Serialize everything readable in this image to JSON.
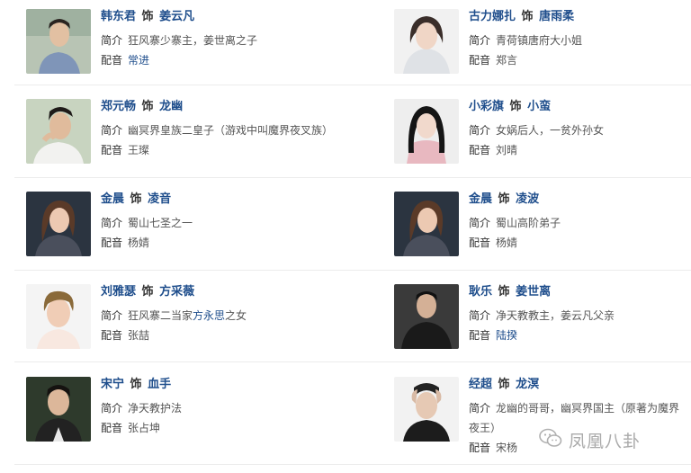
{
  "cast": [
    {
      "actor": "韩东君",
      "role_word": "饰",
      "character": "姜云凡",
      "intro_label": "简介",
      "intro": "狂风寨少寨主，姜世离之子",
      "voice_label": "配音",
      "voice": "常进"
    },
    {
      "actor": "古力娜扎",
      "role_word": "饰",
      "character": "唐雨柔",
      "intro_label": "简介",
      "intro": "青荷镇唐府大小姐",
      "voice_label": "配音",
      "voice": "郑言"
    },
    {
      "actor": "郑元畅",
      "role_word": "饰",
      "character": "龙幽",
      "intro_label": "简介",
      "intro": "幽冥界皇族二皇子（游戏中叫魔界夜叉族）",
      "voice_label": "配音",
      "voice": "王璨"
    },
    {
      "actor": "小彩旗",
      "role_word": "饰",
      "character": "小蛮",
      "intro_label": "简介",
      "intro": "女娲后人，一贫外孙女",
      "voice_label": "配音",
      "voice": "刘晴"
    },
    {
      "actor": "金晨",
      "role_word": "饰",
      "character": "凌音",
      "intro_label": "简介",
      "intro": "蜀山七圣之一",
      "voice_label": "配音",
      "voice": "杨婧"
    },
    {
      "actor": "金晨",
      "role_word": "饰",
      "character": "凌波",
      "intro_label": "简介",
      "intro": "蜀山高阶弟子",
      "voice_label": "配音",
      "voice": "杨婧"
    },
    {
      "actor": "刘雅瑟",
      "role_word": "饰",
      "character": "方采薇",
      "intro_label": "简介",
      "intro_pre": "狂风寨二当家",
      "intro_link": "方永思",
      "intro_post": "之女",
      "voice_label": "配音",
      "voice": "张喆"
    },
    {
      "actor": "耿乐",
      "role_word": "饰",
      "character": "姜世离",
      "intro_label": "简介",
      "intro": "净天教教主，姜云凡父亲",
      "voice_label": "配音",
      "voice": "陆揆"
    },
    {
      "actor": "宋宁",
      "role_word": "饰",
      "character": "血手",
      "intro_label": "简介",
      "intro": "净天教护法",
      "voice_label": "配音",
      "voice": "张占坤"
    },
    {
      "actor": "经超",
      "role_word": "饰",
      "character": "龙溟",
      "intro_label": "简介",
      "intro": "龙幽的哥哥，幽冥界国主（原著为魔界夜王）",
      "voice_label": "配音",
      "voice": "宋杨"
    }
  ],
  "watermark": {
    "text": "凤凰八卦"
  },
  "colors": {
    "name_link": "#1f4e8c",
    "label": "#333333",
    "body_text": "#555555",
    "divider": "#ececec"
  }
}
